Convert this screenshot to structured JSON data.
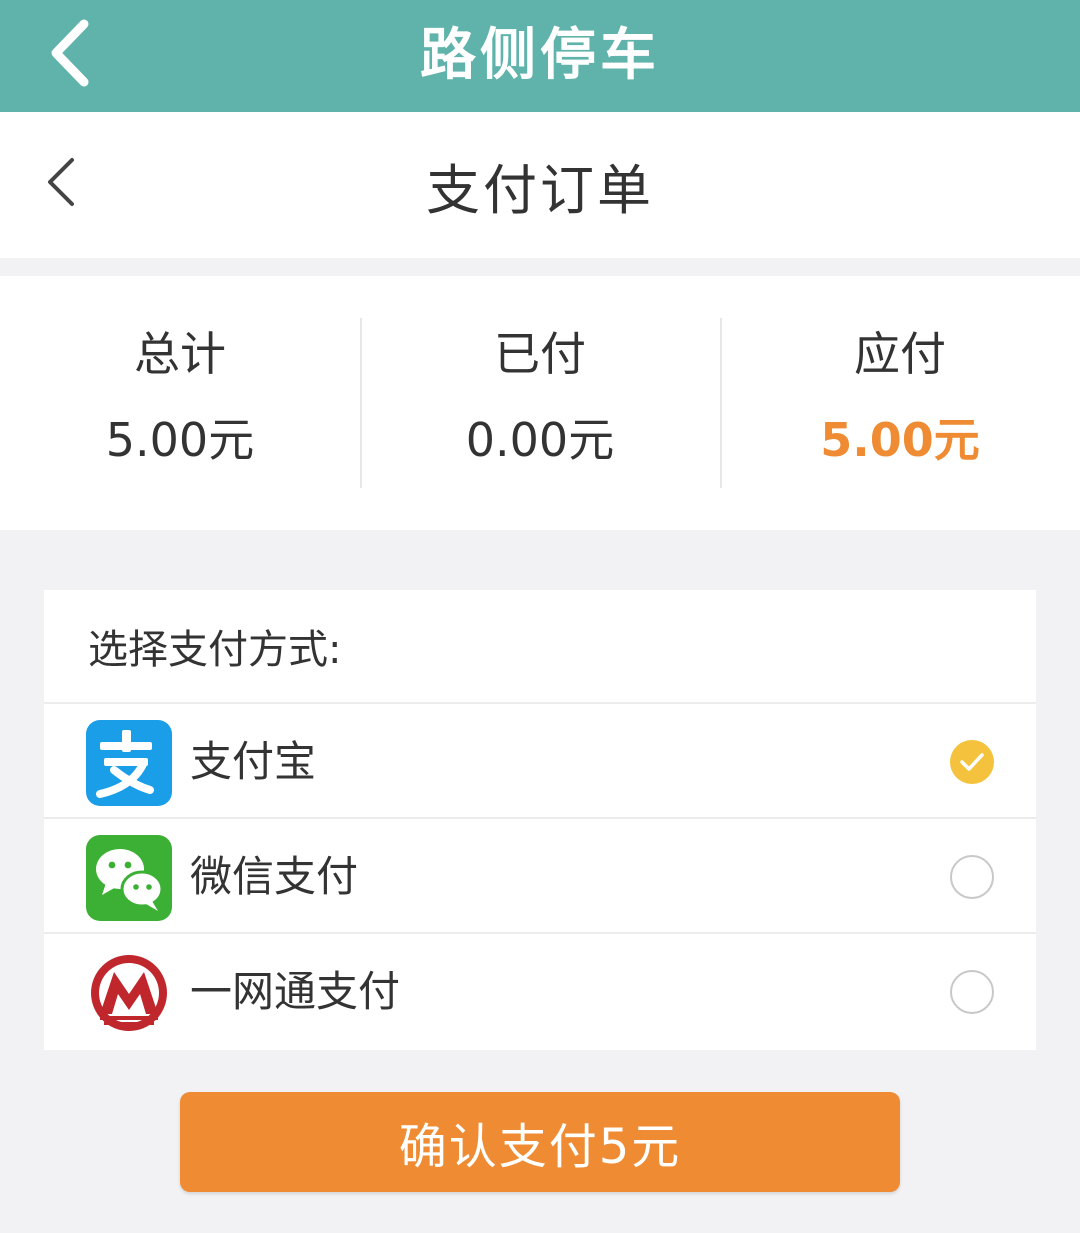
{
  "app_bar": {
    "title": "路侧停车",
    "back_icon": "chevron-left-icon"
  },
  "sub_header": {
    "title": "支付订单",
    "back_icon": "chevron-left-icon"
  },
  "summary": {
    "total_label": "总计",
    "total_value": "5.00元",
    "paid_label": "已付",
    "paid_value": "0.00元",
    "due_label": "应付",
    "due_value": "5.00元"
  },
  "payment": {
    "header": "选择支付方式:",
    "methods": [
      {
        "label": "支付宝",
        "icon": "alipay-icon",
        "selected": true
      },
      {
        "label": "微信支付",
        "icon": "wechat-pay-icon",
        "selected": false
      },
      {
        "label": "一网通支付",
        "icon": "cmb-yiwangtong-icon",
        "selected": false
      }
    ]
  },
  "confirm_button": {
    "label": "确认支付5元"
  },
  "colors": {
    "app_bar": "#5fb3aa",
    "accent_orange": "#ef8b32",
    "checked_yellow": "#f5c23e",
    "alipay_blue": "#1a9ee8",
    "wechat_green": "#3cb035",
    "cmb_red": "#c0272d"
  }
}
